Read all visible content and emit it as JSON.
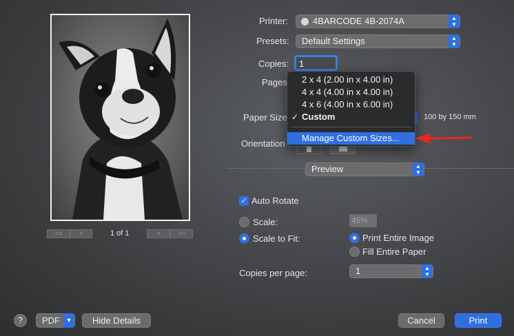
{
  "preview": {
    "page_indicator": "1 of 1",
    "nav_first": "<<",
    "nav_prev": "<",
    "nav_next": ">",
    "nav_last": ">>"
  },
  "form": {
    "printer_label": "Printer:",
    "printer_value": "4BARCODE 4B-2074A",
    "presets_label": "Presets:",
    "presets_value": "Default Settings",
    "copies_label": "Copies:",
    "copies_value": "1",
    "pages_label": "Pages",
    "paper_size_label": "Paper Size",
    "paper_size_dims": "100 by 150 mm",
    "orientation_label": "Orientation"
  },
  "paper_menu": {
    "items": [
      {
        "label": "2 x 4 (2.00 in x 4.00 in)",
        "checked": false
      },
      {
        "label": "4 x 4 (4.00 in x 4.00 in)",
        "checked": false
      },
      {
        "label": "4 x 6 (4.00 in x 6.00 in)",
        "checked": false
      },
      {
        "label": "Custom",
        "checked": true
      }
    ],
    "check_glyph": "✓",
    "manage_label": "Manage Custom Sizes..."
  },
  "section": {
    "value": "Preview"
  },
  "options": {
    "auto_rotate": "Auto Rotate",
    "auto_rotate_checked": true,
    "scale_label": "Scale:",
    "scale_value": "45%",
    "scale_to_fit": "Scale to Fit:",
    "print_entire_image": "Print Entire Image",
    "fill_entire_paper": "Fill Entire Paper",
    "copies_per_page_label": "Copies per page:",
    "copies_per_page_value": "1"
  },
  "footer": {
    "help": "?",
    "pdf": "PDF",
    "hide_details": "Hide Details",
    "cancel": "Cancel",
    "print": "Print"
  },
  "colors": {
    "accent": "#2f6fe0",
    "annotation_arrow": "#e8281f"
  }
}
